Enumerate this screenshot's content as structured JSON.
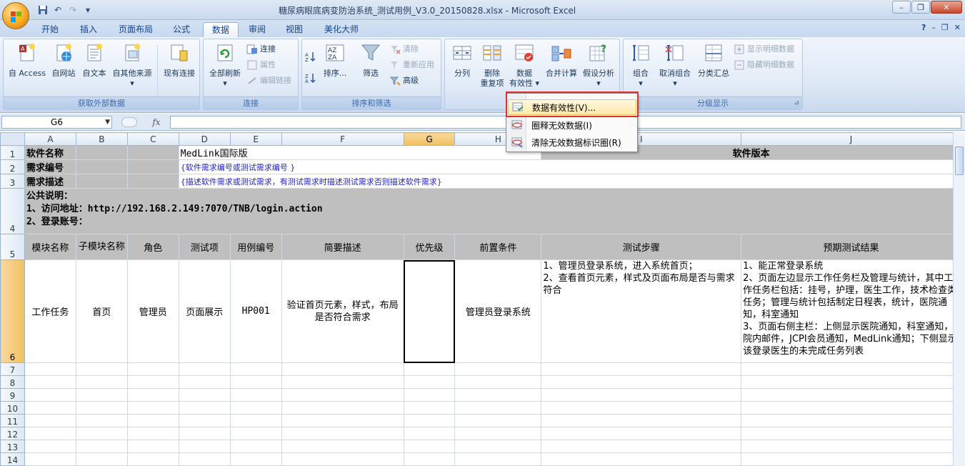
{
  "window": {
    "title": "糖尿病眼底病变防治系统_测试用例_V3.0_20150828.xlsx - Microsoft Excel",
    "minimize": "–",
    "restore": "❐",
    "close": "✕"
  },
  "qat": {
    "save": "💾",
    "undo": "↶",
    "redo": "↷",
    "customize": "▾"
  },
  "tabs": [
    "开始",
    "插入",
    "页面布局",
    "公式",
    "数据",
    "审阅",
    "视图",
    "美化大师"
  ],
  "tab_ctrls": {
    "help": "?",
    "min": "–",
    "restore": "❐",
    "close": "✕"
  },
  "ribbon": {
    "external": {
      "label": "获取外部数据",
      "access": "自 Access",
      "web": "自网站",
      "text": "自文本",
      "other": "自其他来源",
      "existing": "现有连接"
    },
    "connections": {
      "label": "连接",
      "refresh": "全部刷新",
      "connect": "连接",
      "props": "属性",
      "edit_links": "编辑链接"
    },
    "sort_filter": {
      "label": "排序和筛选",
      "sort": "排序...",
      "filter": "筛选",
      "clear": "清除",
      "reapply": "重新应用",
      "advanced": "高级"
    },
    "data_tools": {
      "split": "分列",
      "remove_dup_1": "删除",
      "remove_dup_2": "重复项",
      "validation_1": "数据",
      "validation_2": "有效性",
      "consolidate": "合并计算",
      "whatif": "假设分析"
    },
    "outline": {
      "label": "分级显示",
      "group": "组合",
      "ungroup": "取消组合",
      "subtotal": "分类汇总",
      "show_detail": "显示明细数据",
      "hide_detail": "隐藏明细数据"
    }
  },
  "formula_bar": {
    "name_box": "G6",
    "fx": "fx",
    "value": ""
  },
  "dropdown": {
    "items": [
      "数据有效性(V)...",
      "圈释无效数据(I)",
      "清除无效数据标识圈(R)"
    ]
  },
  "columns": [
    "A",
    "B",
    "C",
    "D",
    "E",
    "F",
    "G",
    "H",
    "I",
    "J"
  ],
  "rows": [
    "1",
    "2",
    "3",
    "4",
    "5",
    "6",
    "7",
    "8",
    "9",
    "10",
    "11",
    "12",
    "13",
    "14"
  ],
  "sheet": {
    "r1": {
      "label": "软件名称",
      "value": "MedLink国际版",
      "version": "软件版本"
    },
    "r2": {
      "label": "需求编号",
      "value": "{软件需求编号或测试需求编号 }"
    },
    "r3": {
      "label": "需求描述",
      "value": "{描述软件需求或测试需求，有测试需求时描述测试需求否则描述软件需求}"
    },
    "r4": {
      "line1": "公共说明：",
      "line2": "1、访问地址：http://192.168.2.149:7070/TNB/login.action",
      "line3": "2、登录账号："
    },
    "headers": [
      "模块名称",
      "子模块名称",
      "角色",
      "测试项",
      "用例编号",
      "简要描述",
      "优先级",
      "前置条件",
      "测试步骤",
      "预期测试结果"
    ],
    "row6": {
      "module": "工作任务",
      "submodule": "首页",
      "role": "管理员",
      "item": "页面展示",
      "case_id": "HP001",
      "desc": "验证首页元素，样式，布局是否符合需求",
      "priority": "",
      "precondition": "管理员登录系统",
      "steps": "1、管理员登录系统，进入系统首页；\n2、查看首页元素，样式及页面布局是否与需求符合",
      "expected": "1、能正常登录系统\n2、页面左边显示工作任务栏及管理与统计，其中工作任务栏包括：挂号，护理，医生工作，技术检查类任务；管理与统计包括制定日程表，统计，医院通知，科室通知\n3、页面右侧主栏：上侧显示医院通知，科室通知，院内邮件，JCPI会员通知，MedLink通知；下侧显示该登录医生的未完成任务列表"
    }
  }
}
